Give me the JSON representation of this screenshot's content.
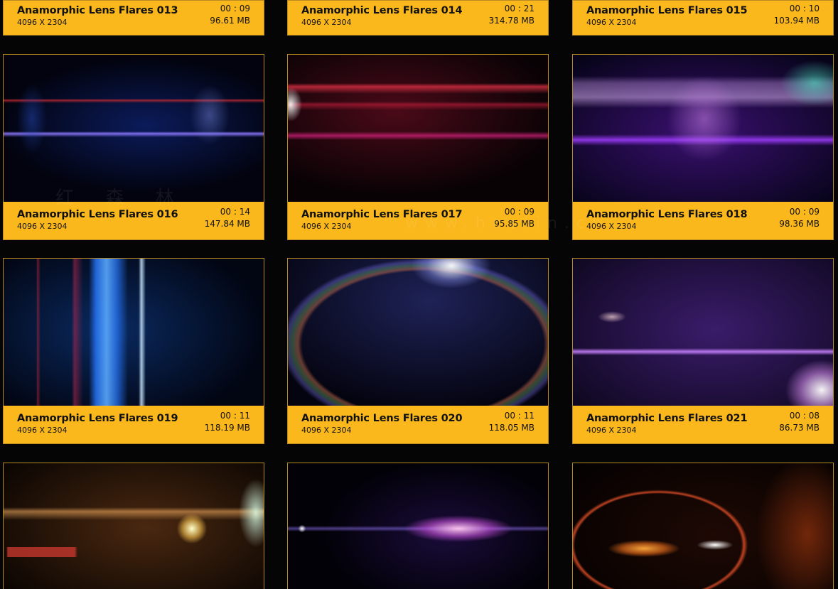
{
  "watermark": {
    "cn": "红 森 林",
    "url": "www.hoslin.cn"
  },
  "cards": [
    {
      "title": "Anamorphic Lens Flares 013",
      "resolution": "4096 X 2304",
      "duration": "00 : 09",
      "size": "96.61 MB"
    },
    {
      "title": "Anamorphic Lens Flares 014",
      "resolution": "4096 X 2304",
      "duration": "00 : 21",
      "size": "314.78 MB"
    },
    {
      "title": "Anamorphic Lens Flares 015",
      "resolution": "4096 X 2304",
      "duration": "00 : 10",
      "size": "103.94 MB"
    },
    {
      "title": "Anamorphic Lens Flares 016",
      "resolution": "4096 X 2304",
      "duration": "00 : 14",
      "size": "147.84 MB"
    },
    {
      "title": "Anamorphic Lens Flares 017",
      "resolution": "4096 X 2304",
      "duration": "00 : 09",
      "size": "95.85 MB"
    },
    {
      "title": "Anamorphic Lens Flares 018",
      "resolution": "4096 X 2304",
      "duration": "00 : 09",
      "size": "98.36 MB"
    },
    {
      "title": "Anamorphic Lens Flares 019",
      "resolution": "4096 X 2304",
      "duration": "00 : 11",
      "size": "118.19 MB"
    },
    {
      "title": "Anamorphic Lens Flares 020",
      "resolution": "4096 X 2304",
      "duration": "00 : 11",
      "size": "118.05 MB"
    },
    {
      "title": "Anamorphic Lens Flares 021",
      "resolution": "4096 X 2304",
      "duration": "00 : 08",
      "size": "86.73 MB"
    },
    {
      "title": "",
      "resolution": "",
      "duration": "",
      "size": ""
    },
    {
      "title": "",
      "resolution": "",
      "duration": "",
      "size": ""
    },
    {
      "title": "",
      "resolution": "",
      "duration": "",
      "size": ""
    }
  ],
  "colors": {
    "accent": "#fbb81c",
    "border": "#b88a20",
    "background": "#050506"
  }
}
